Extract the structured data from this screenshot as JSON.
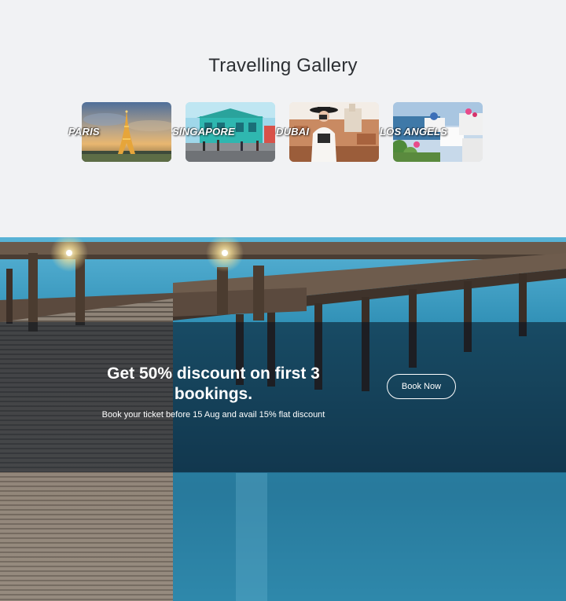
{
  "gallery": {
    "title": "Travelling Gallery",
    "cards": [
      {
        "label": "PARIS",
        "image": "eiffel-tower-photo"
      },
      {
        "label": "SINGAPORE",
        "image": "street-market-photo"
      },
      {
        "label": "DUBAI",
        "image": "traveler-with-camera-photo"
      },
      {
        "label": "LOS ANGELS",
        "image": "coastal-village-photo"
      }
    ]
  },
  "promo": {
    "heading": "Get 50% discount on first 3 bookings.",
    "subtext": "Book your ticket before 15 Aug and avail 15% flat discount",
    "button_label": "Book Now",
    "background_image": "wooden-pier-over-water-photo"
  },
  "colors": {
    "page_background": "#f1f2f4",
    "title_text": "#2c2f33",
    "overlay": "#05121f",
    "water": "#2f8fb5"
  }
}
